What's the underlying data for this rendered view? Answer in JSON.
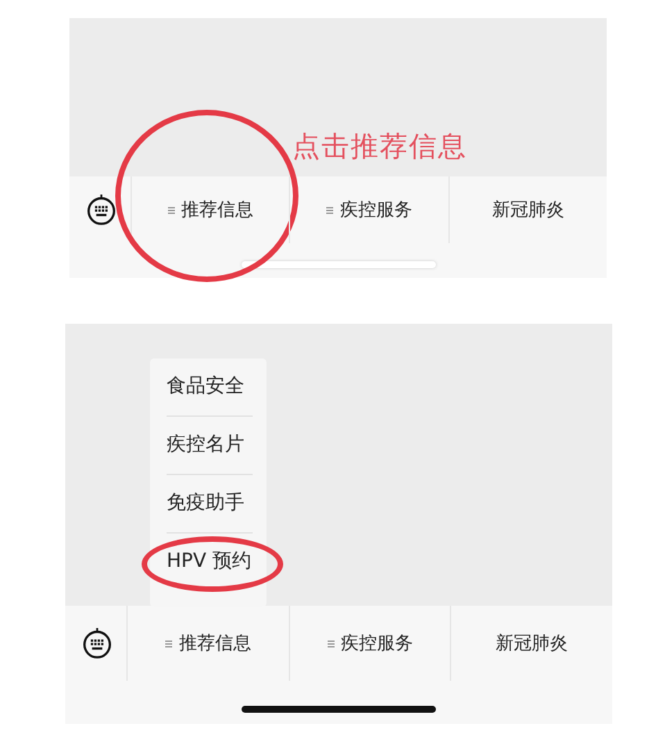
{
  "panels": [
    {
      "caption": "点击推荐信息",
      "home_indicator_dark": false,
      "tabs": [
        {
          "label": "推荐信息",
          "kind": "menu",
          "highlighted": true
        },
        {
          "label": "疾控服务",
          "kind": "menu",
          "highlighted": false
        },
        {
          "label": "新冠肺炎",
          "kind": "plain",
          "highlighted": false
        }
      ]
    },
    {
      "menu_items": [
        {
          "label": "食品安全",
          "highlighted": false
        },
        {
          "label": "疾控名片",
          "highlighted": false
        },
        {
          "label": "免疫助手",
          "highlighted": false
        },
        {
          "label": "HPV 预约",
          "highlighted": true
        }
      ],
      "home_indicator_dark": true,
      "tabs": [
        {
          "label": "推荐信息",
          "kind": "menu",
          "highlighted": false
        },
        {
          "label": "疾控服务",
          "kind": "menu",
          "highlighted": false
        },
        {
          "label": "新冠肺炎",
          "kind": "plain",
          "highlighted": false
        }
      ]
    }
  ]
}
